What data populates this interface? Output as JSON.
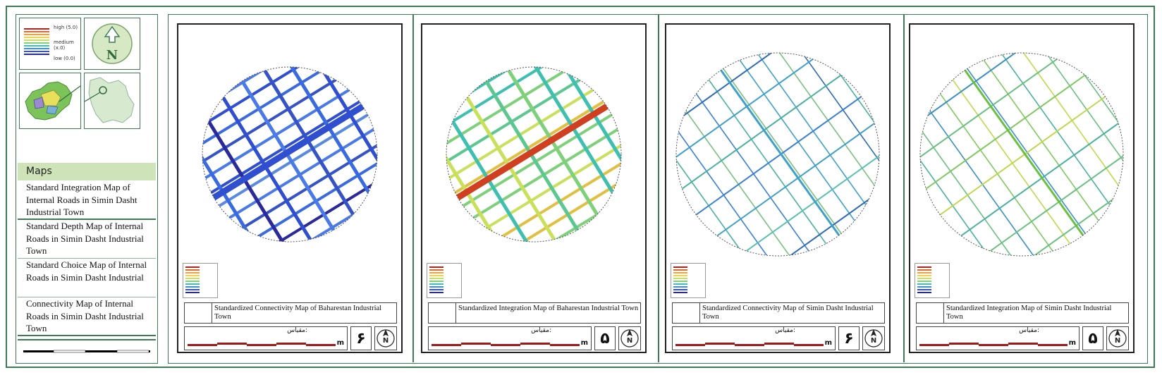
{
  "legend": {
    "high": "high (5.0)",
    "medium": "medium (x.0)",
    "low": "low (0.0)",
    "colors": [
      "#b22222",
      "#e06a2c",
      "#f0a13b",
      "#f4cf4a",
      "#c8e05a",
      "#7fd07a",
      "#3fbfb0",
      "#3a8fd6",
      "#3553c7",
      "#2b2a9a"
    ]
  },
  "north_label": "N",
  "sidebar": {
    "maps_heading": "Maps",
    "items": [
      "Standard Integration Map of Internal Roads in Simin Dasht Industrial Town",
      "Standard Depth Map of Internal Roads in Simin Dasht Industrial Town",
      "Standard Choice Map of Internal Roads in Simin Dasht Industrial",
      "Connectivity Map of Internal Roads in Simin Dasht Industrial Town"
    ]
  },
  "panels": [
    {
      "title": "Standardized Connectivity Map of Baharestan Industrial Town",
      "number": "۶",
      "scale_label": "مقیاس:",
      "unit": "m",
      "palette": "blue"
    },
    {
      "title": "Standardized Integration Map of Baharestan Industrial Town",
      "number": "۵",
      "scale_label": "مقیاس:",
      "unit": "m",
      "palette": "green"
    },
    {
      "title": "Standardized Connectivity Map of Simin Dasht Industrial Town",
      "number": "۶",
      "scale_label": "مقیاس:",
      "unit": "m",
      "palette": "cyan"
    },
    {
      "title": "Standardized Integration Map of Simin Dasht Industrial Town",
      "number": "۵",
      "scale_label": "مقیاس:",
      "unit": "m",
      "palette": "lime"
    }
  ]
}
